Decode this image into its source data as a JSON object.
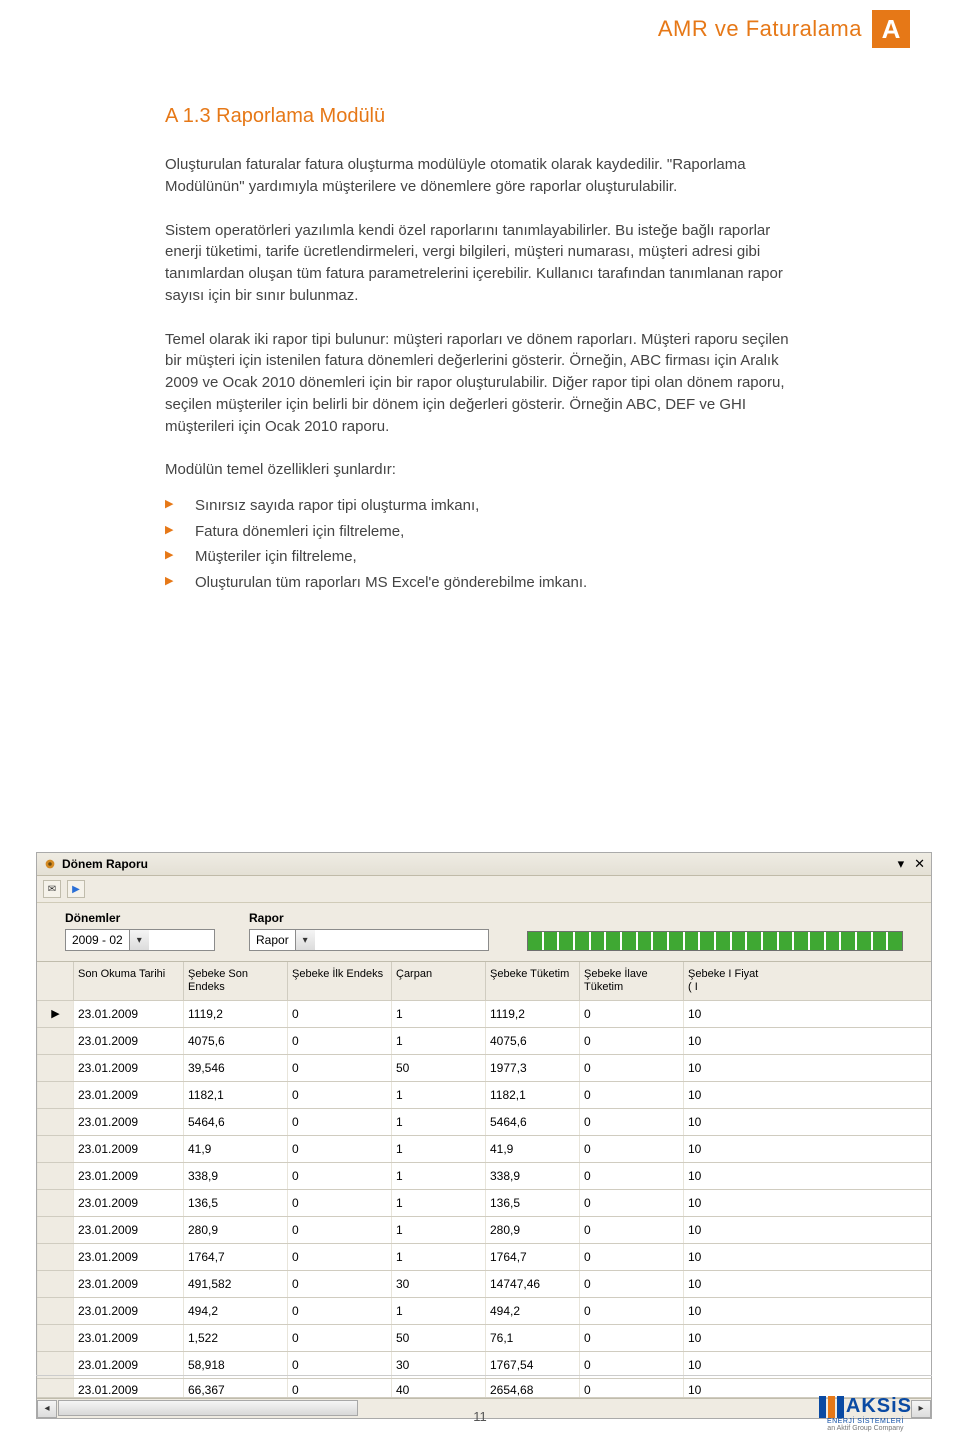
{
  "header": {
    "title": "AMR ve Faturalama",
    "badge": "A"
  },
  "section_title": "A 1.3 Raporlama Modülü",
  "paragraphs": [
    "Oluşturulan faturalar fatura oluşturma modülüyle otomatik olarak kaydedilir. \"Raporlama Modülünün\" yardımıyla müşterilere ve dönemlere göre raporlar oluşturulabilir.",
    "Sistem operatörleri yazılımla kendi özel raporlarını tanımlayabilirler. Bu isteğe bağlı raporlar enerji tüketimi, tarife ücretlendirmeleri, vergi bilgileri, müşteri numarası, müşteri adresi gibi tanımlardan oluşan tüm fatura parametrelerini içerebilir. Kullanıcı tarafından tanımlanan rapor sayısı için bir sınır bulunmaz.",
    "Temel olarak iki rapor tipi bulunur: müşteri raporları ve dönem raporları. Müşteri raporu seçilen bir müşteri için istenilen fatura dönemleri değerlerini gösterir. Örneğin, ABC firması için Aralık 2009 ve Ocak 2010 dönemleri için bir rapor oluşturulabilir. Diğer rapor tipi olan dönem raporu, seçilen müşteriler için belirli bir dönem için değerleri gösterir. Örneğin ABC, DEF ve GHI müşterileri için Ocak 2010 raporu.",
    "Modülün temel özellikleri şunlardır:"
  ],
  "bullets": [
    "Sınırsız sayıda rapor tipi oluşturma imkanı,",
    "Fatura dönemleri için filtreleme,",
    "Müşteriler için filtreleme,",
    "Oluşturulan tüm raporları MS Excel'e gönderebilme imkanı."
  ],
  "window": {
    "title": "Dönem Raporu",
    "filters": {
      "donemler_label": "Dönemler",
      "donemler_value": "2009 - 02",
      "rapor_label": "Rapor",
      "rapor_value": "Rapor"
    },
    "columns": [
      "Son Okuma Tarihi",
      "Şebeke Son Endeks",
      "Şebeke İlk Endeks",
      "Çarpan",
      "Şebeke Tüketim",
      "Şebeke İlave Tüketim",
      "Şebeke I Fiyat ( I"
    ],
    "rows": [
      [
        "23.01.2009",
        "1119,2",
        "0",
        "1",
        "1119,2",
        "0",
        "10"
      ],
      [
        "23.01.2009",
        "4075,6",
        "0",
        "1",
        "4075,6",
        "0",
        "10"
      ],
      [
        "23.01.2009",
        "39,546",
        "0",
        "50",
        "1977,3",
        "0",
        "10"
      ],
      [
        "23.01.2009",
        "1182,1",
        "0",
        "1",
        "1182,1",
        "0",
        "10"
      ],
      [
        "23.01.2009",
        "5464,6",
        "0",
        "1",
        "5464,6",
        "0",
        "10"
      ],
      [
        "23.01.2009",
        "41,9",
        "0",
        "1",
        "41,9",
        "0",
        "10"
      ],
      [
        "23.01.2009",
        "338,9",
        "0",
        "1",
        "338,9",
        "0",
        "10"
      ],
      [
        "23.01.2009",
        "136,5",
        "0",
        "1",
        "136,5",
        "0",
        "10"
      ],
      [
        "23.01.2009",
        "280,9",
        "0",
        "1",
        "280,9",
        "0",
        "10"
      ],
      [
        "23.01.2009",
        "1764,7",
        "0",
        "1",
        "1764,7",
        "0",
        "10"
      ],
      [
        "23.01.2009",
        "491,582",
        "0",
        "30",
        "14747,46",
        "0",
        "10"
      ],
      [
        "23.01.2009",
        "494,2",
        "0",
        "1",
        "494,2",
        "0",
        "10"
      ],
      [
        "23.01.2009",
        "1,522",
        "0",
        "50",
        "76,1",
        "0",
        "10"
      ],
      [
        "23.01.2009",
        "58,918",
        "0",
        "30",
        "1767,54",
        "0",
        "10"
      ],
      [
        "23.01.2009",
        "66,367",
        "0",
        "40",
        "2654,68",
        "0",
        "10"
      ]
    ]
  },
  "page_number": "11",
  "brand": {
    "name": "AKSiS",
    "sub": "ENERJİ SİSTEMLERİ",
    "sub2": "an Aktif Group Company"
  }
}
